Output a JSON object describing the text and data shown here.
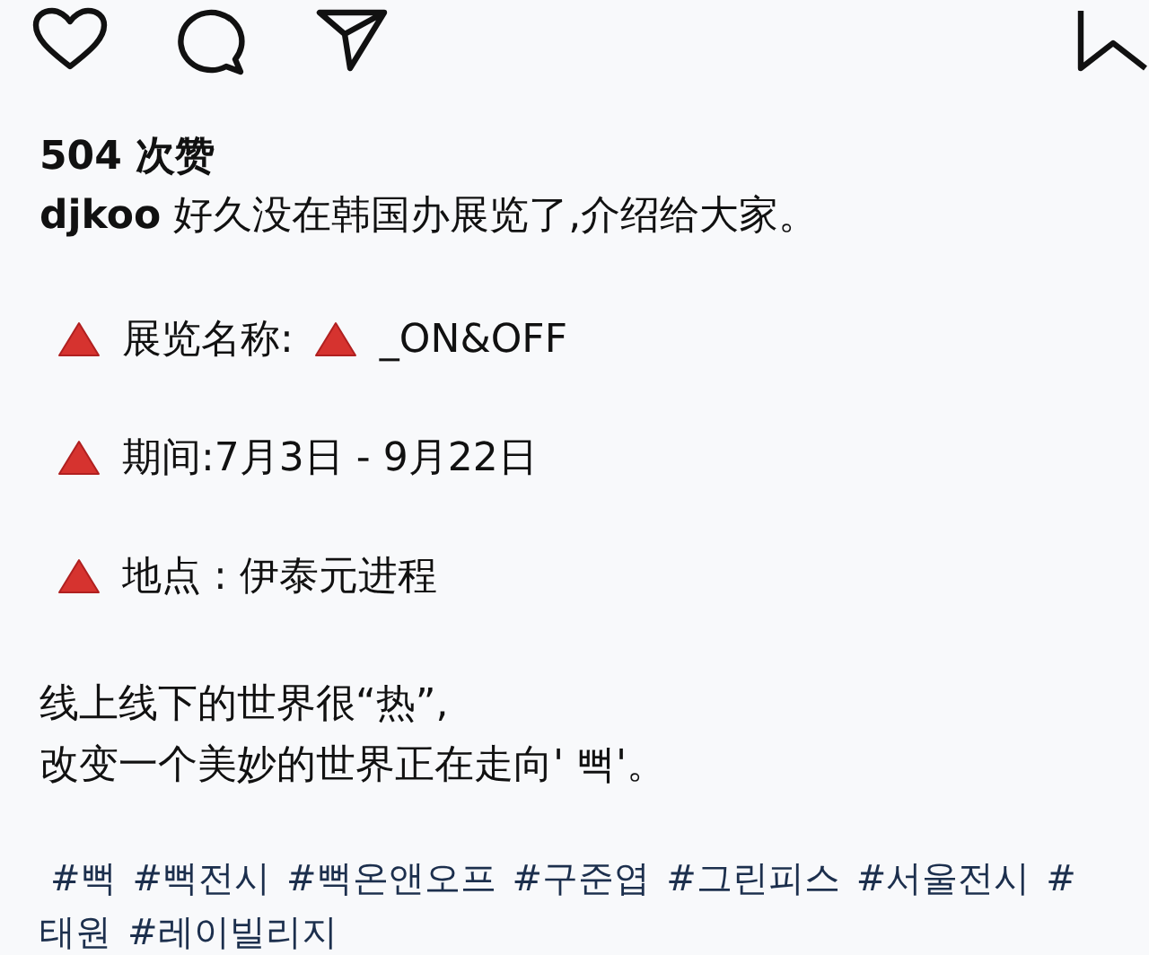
{
  "likes": "504 次赞",
  "caption": {
    "username": "djkoo",
    "text": "好久没在韩国办展览了,介绍给大家。"
  },
  "details": [
    {
      "parts": [
        {
          "kind": "triangle"
        },
        {
          "kind": "text",
          "text": "展览名称:"
        },
        {
          "kind": "triangle"
        },
        {
          "kind": "text",
          "text": "_ON&OFF"
        }
      ]
    },
    {
      "parts": [
        {
          "kind": "triangle"
        },
        {
          "kind": "text",
          "text": "期间:7月3日 - 9月22日"
        }
      ]
    },
    {
      "parts": [
        {
          "kind": "triangle"
        },
        {
          "kind": "text",
          "text": "地点 : 伊泰元进程"
        }
      ]
    }
  ],
  "paragraph": [
    "线上线下的世界很“热”,",
    "改变一个美妙的世界正在走向' 뻑'。"
  ],
  "hashtag_lines": [
    [
      "#뻑",
      "#뻑전시",
      "#뻑온앤오프",
      "#구준엽",
      "#그린피스",
      "#서울전시",
      "#"
    ],
    [
      "태원",
      "#레이빌리지"
    ]
  ]
}
